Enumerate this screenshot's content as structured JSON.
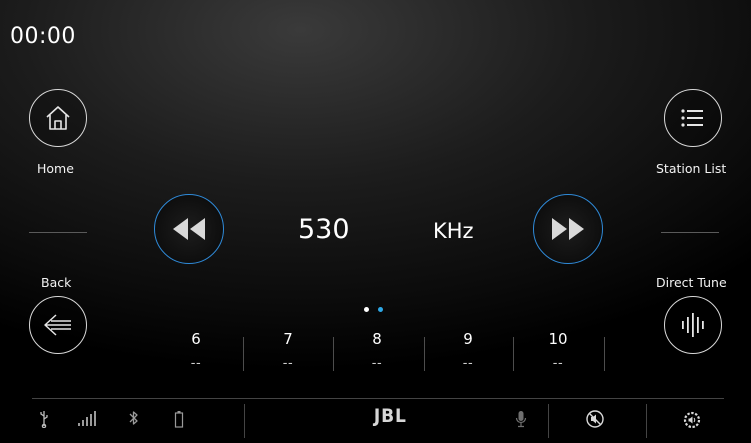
{
  "clock": "00:00",
  "left_panel": {
    "home_label": "Home",
    "back_label": "Back"
  },
  "right_panel": {
    "station_list_label": "Station List",
    "direct_tune_label": "Direct Tune"
  },
  "tuner": {
    "frequency": "530",
    "unit": "KHz"
  },
  "page_indicator": {
    "pages": 2,
    "active": 2,
    "active_color": "#2ea8e6",
    "inactive_color": "#ffffff"
  },
  "presets": [
    {
      "number": "6",
      "value": "--"
    },
    {
      "number": "7",
      "value": "--"
    },
    {
      "number": "8",
      "value": "--"
    },
    {
      "number": "9",
      "value": "--"
    },
    {
      "number": "10",
      "value": "--"
    }
  ],
  "status_bar": {
    "brand": "JBL",
    "icons": [
      "usb-icon",
      "signal-bars-icon",
      "bluetooth-icon",
      "battery-icon",
      "microphone-icon",
      "mute-icon",
      "volume-settings-icon"
    ]
  },
  "colors": {
    "accent": "#2f8ad8",
    "background": "#000000",
    "text": "#ffffff"
  }
}
